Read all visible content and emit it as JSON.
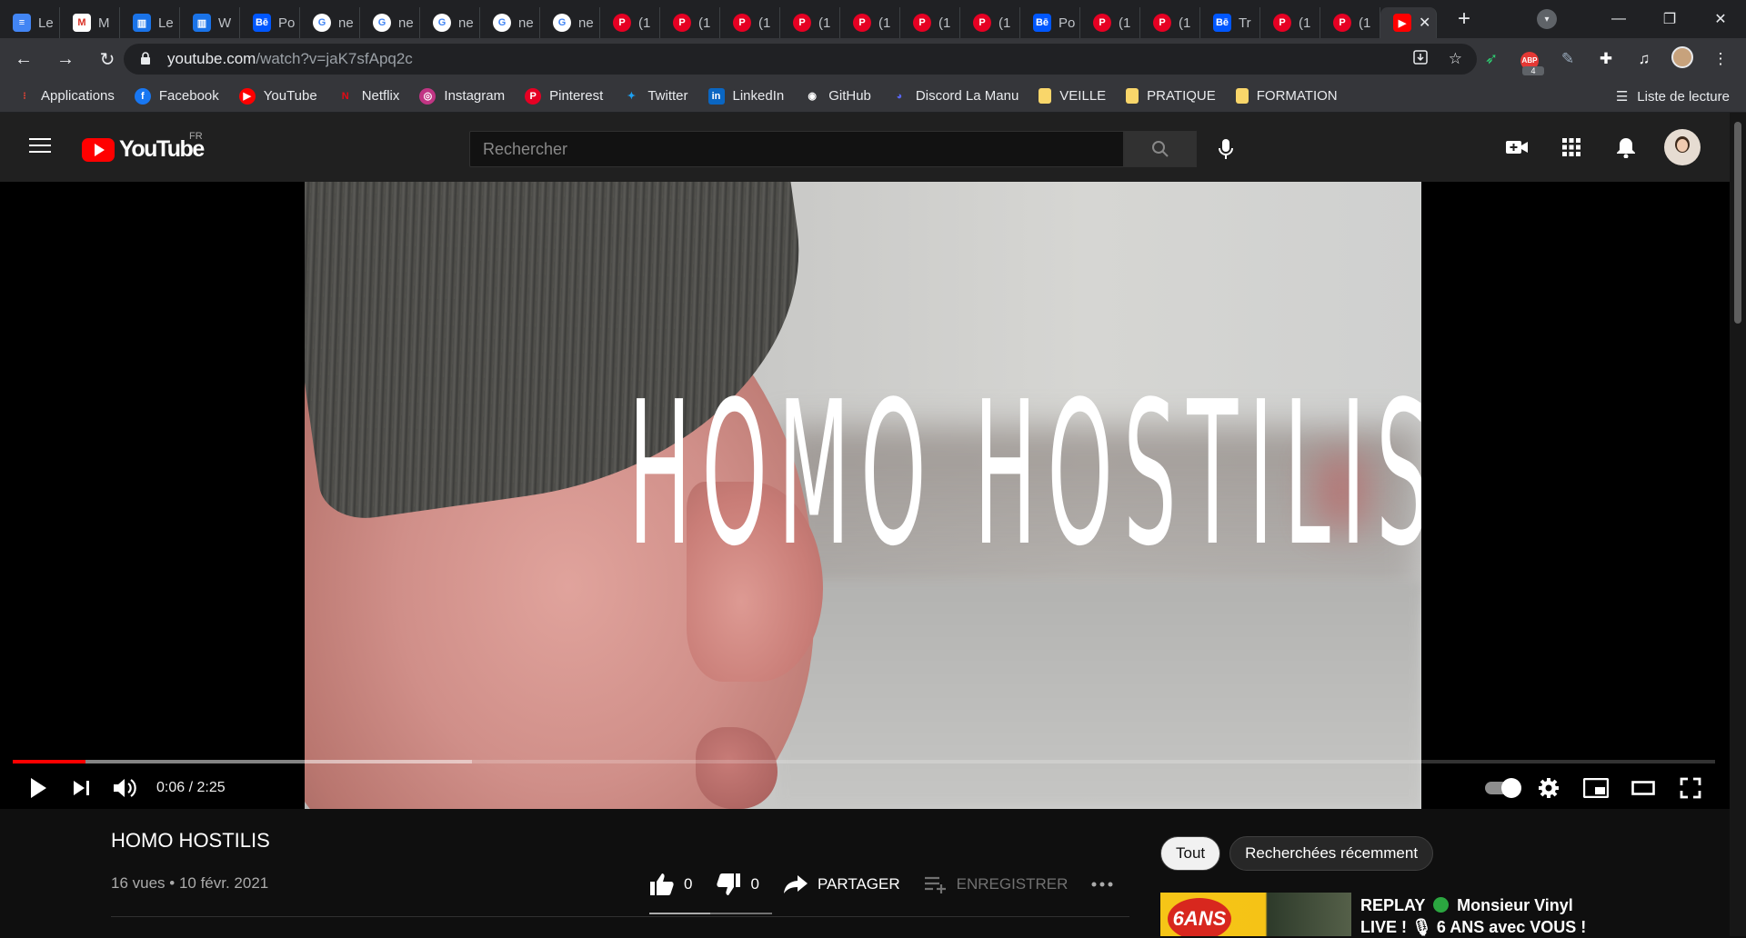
{
  "browser": {
    "tabs": [
      {
        "label": "Le",
        "icon": "docs-icon"
      },
      {
        "label": "M",
        "icon": "gmail-icon"
      },
      {
        "label": "Le",
        "icon": "chart-icon"
      },
      {
        "label": "W",
        "icon": "chart-icon"
      },
      {
        "label": "Po",
        "icon": "behance-icon"
      },
      {
        "label": "ne",
        "icon": "google-icon"
      },
      {
        "label": "ne",
        "icon": "google-icon"
      },
      {
        "label": "ne",
        "icon": "google-icon"
      },
      {
        "label": "ne",
        "icon": "google-icon"
      },
      {
        "label": "ne",
        "icon": "google-icon"
      },
      {
        "label": "(1",
        "icon": "pinterest-icon"
      },
      {
        "label": "(1",
        "icon": "pinterest-icon"
      },
      {
        "label": "(1",
        "icon": "pinterest-icon"
      },
      {
        "label": "(1",
        "icon": "pinterest-icon"
      },
      {
        "label": "(1",
        "icon": "pinterest-icon"
      },
      {
        "label": "(1",
        "icon": "pinterest-icon"
      },
      {
        "label": "(1",
        "icon": "pinterest-icon"
      },
      {
        "label": "Po",
        "icon": "behance-icon"
      },
      {
        "label": "(1",
        "icon": "pinterest-icon"
      },
      {
        "label": "(1",
        "icon": "pinterest-icon"
      },
      {
        "label": "Tr",
        "icon": "behance-icon"
      },
      {
        "label": "(1",
        "icon": "pinterest-icon"
      },
      {
        "label": "(1",
        "icon": "pinterest-icon"
      }
    ],
    "url_host": "youtube.com",
    "url_path": "/watch?v=jaK7sfApq2c",
    "extension_badge": "4",
    "bookmarks": [
      {
        "label": "Applications",
        "icon": "apps-grid-icon",
        "color": "#ea4335"
      },
      {
        "label": "Facebook",
        "icon": "facebook-icon",
        "color": "#1877f2"
      },
      {
        "label": "YouTube",
        "icon": "youtube-icon",
        "color": "#ff0000"
      },
      {
        "label": "Netflix",
        "icon": "netflix-icon",
        "color": "#e50914"
      },
      {
        "label": "Instagram",
        "icon": "instagram-icon",
        "color": "#c13584"
      },
      {
        "label": "Pinterest",
        "icon": "pinterest-icon",
        "color": "#e60023"
      },
      {
        "label": "Twitter",
        "icon": "twitter-icon",
        "color": "#1da1f2"
      },
      {
        "label": "LinkedIn",
        "icon": "linkedin-icon",
        "color": "#0a66c2"
      },
      {
        "label": "GitHub",
        "icon": "github-icon",
        "color": "#ffffff"
      },
      {
        "label": "Discord La Manu",
        "icon": "discord-icon",
        "color": "#5865f2"
      },
      {
        "label": "VEILLE",
        "icon": "folder-icon",
        "color": "#f9d66a"
      },
      {
        "label": "PRATIQUE",
        "icon": "folder-icon",
        "color": "#f9d66a"
      },
      {
        "label": "FORMATION",
        "icon": "folder-icon",
        "color": "#f9d66a"
      }
    ],
    "reading_list": "Liste de lecture"
  },
  "youtube": {
    "wordmark": "YouTube",
    "region": "FR",
    "search_placeholder": "Rechercher",
    "accent": "#ff0000"
  },
  "player": {
    "overlay_title": "HOMO HOSTILIS",
    "time": "0:06 / 2:25",
    "played_fraction": 0.043,
    "buffered_fraction": 0.27
  },
  "video": {
    "title": "HOMO HOSTILIS",
    "meta": "16 vues • 10 févr. 2021",
    "likes": "0",
    "dislikes": "0",
    "share_label": "PARTAGER",
    "save_label": "ENREGISTRER"
  },
  "sidebar": {
    "chips": [
      "Tout",
      "Recherchées récemment"
    ],
    "recommendation": {
      "title_line1_a": "REPLAY",
      "title_line1_b": "Monsieur Vinyl",
      "title_line2": "LIVE ! 🎙 6 ANS avec VOUS !",
      "thumb_badge": "6ANS"
    }
  }
}
